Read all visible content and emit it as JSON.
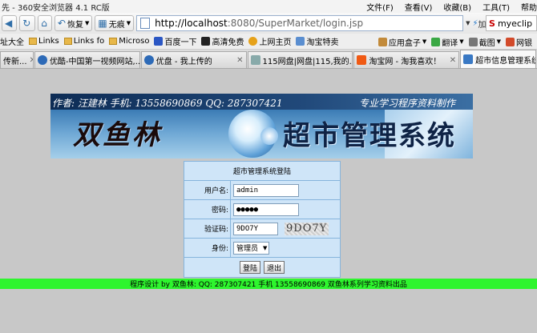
{
  "window": {
    "title": "先 - 360安全浏览器 4.1 RC版"
  },
  "menu": [
    "文件(F)",
    "查看(V)",
    "收藏(B)",
    "工具(T)",
    "帮助"
  ],
  "toolbar": {
    "back": "恢复",
    "mode": "无痕",
    "url_host": "http://localhost",
    "url_rest": ":8080/SuperMarket/login.jsp",
    "go": "加速",
    "search_text": "myeclip"
  },
  "bookmarks": {
    "left": [
      "址大全",
      "Links",
      "Links fo",
      "Microso",
      "百度一下",
      "高清免费",
      "上网主页",
      "淘宝特卖"
    ],
    "right": [
      "应用盒子",
      "翻译",
      "截图",
      "网银"
    ]
  },
  "tabs": [
    {
      "label": "传新..."
    },
    {
      "label": "优酷-中国第一视频网站,..."
    },
    {
      "label": "优盘 - 我上传的"
    },
    {
      "label": "115网盘|网盘|115,我的..."
    },
    {
      "label": "淘宝网 - 淘我喜欢！"
    },
    {
      "label": "超市信息管理系统"
    }
  ],
  "banner": {
    "author": "作者: 汪建林      手机: 13558690869      QQ: 287307421",
    "slogan": "专业学习程序资料制作",
    "name": "双鱼林",
    "system": "超市管理系统"
  },
  "login": {
    "title": "超市管理系统登陆",
    "username_label": "用户名:",
    "username_value": "admin",
    "password_label": "密码:",
    "password_value": "●●●●●",
    "captcha_label": "验证码:",
    "captcha_value": "9DO7Y",
    "captcha_image": "9DO7Y",
    "role_label": "身份:",
    "role_value": "管理员",
    "login_button": "登陆",
    "exit_button": "退出"
  },
  "footer": {
    "text": "程序设计 by 双鱼林: QQ: 287307421 手机 13558690869 双鱼林系列学习资料出品"
  }
}
